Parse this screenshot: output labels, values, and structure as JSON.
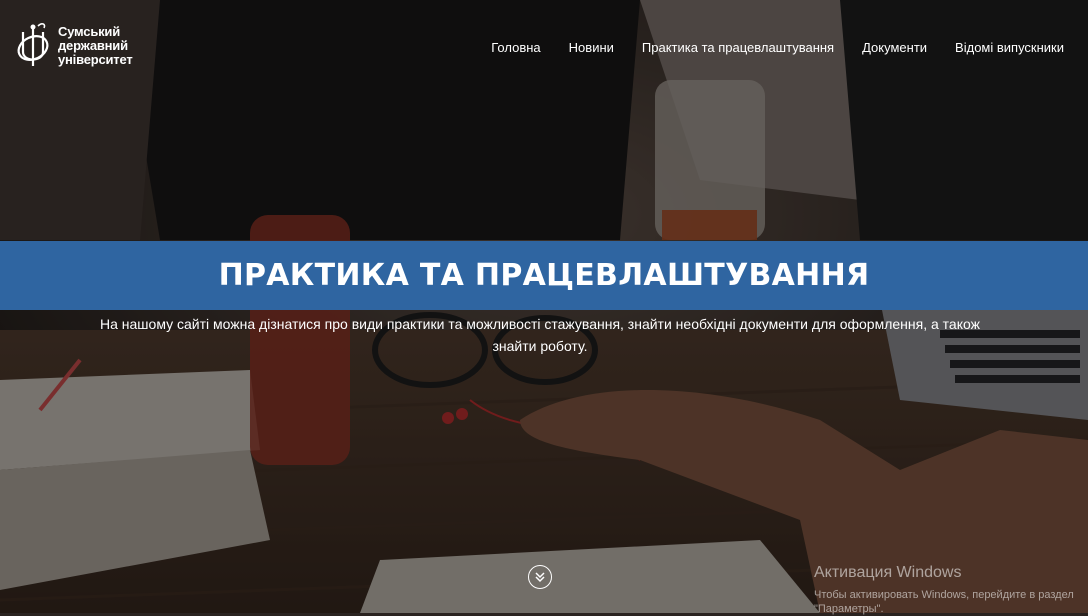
{
  "brand": {
    "lines": [
      "Сумський",
      "державний",
      "університет"
    ]
  },
  "nav": {
    "items": [
      {
        "label": "Головна"
      },
      {
        "label": "Новини"
      },
      {
        "label": "Практика та працевлаштування"
      },
      {
        "label": "Документи"
      },
      {
        "label": "Відомі випускники"
      }
    ]
  },
  "hero": {
    "title": "ПРАКТИКА ТА ПРАЦЕВЛАШТУВАННЯ",
    "description": "На нашому сайті можна дізнатися про види практики та можливості стажування, знайти необхідні документи для оформлення, а також знайти роботу.",
    "band_color": "#2f65a1",
    "scroll_icon": "double-chevron-down-icon"
  },
  "watermark": {
    "title": "Активация Windows",
    "subtitle": "Чтобы активировать Windows, перейдите в раздел \"Параметры\"."
  }
}
